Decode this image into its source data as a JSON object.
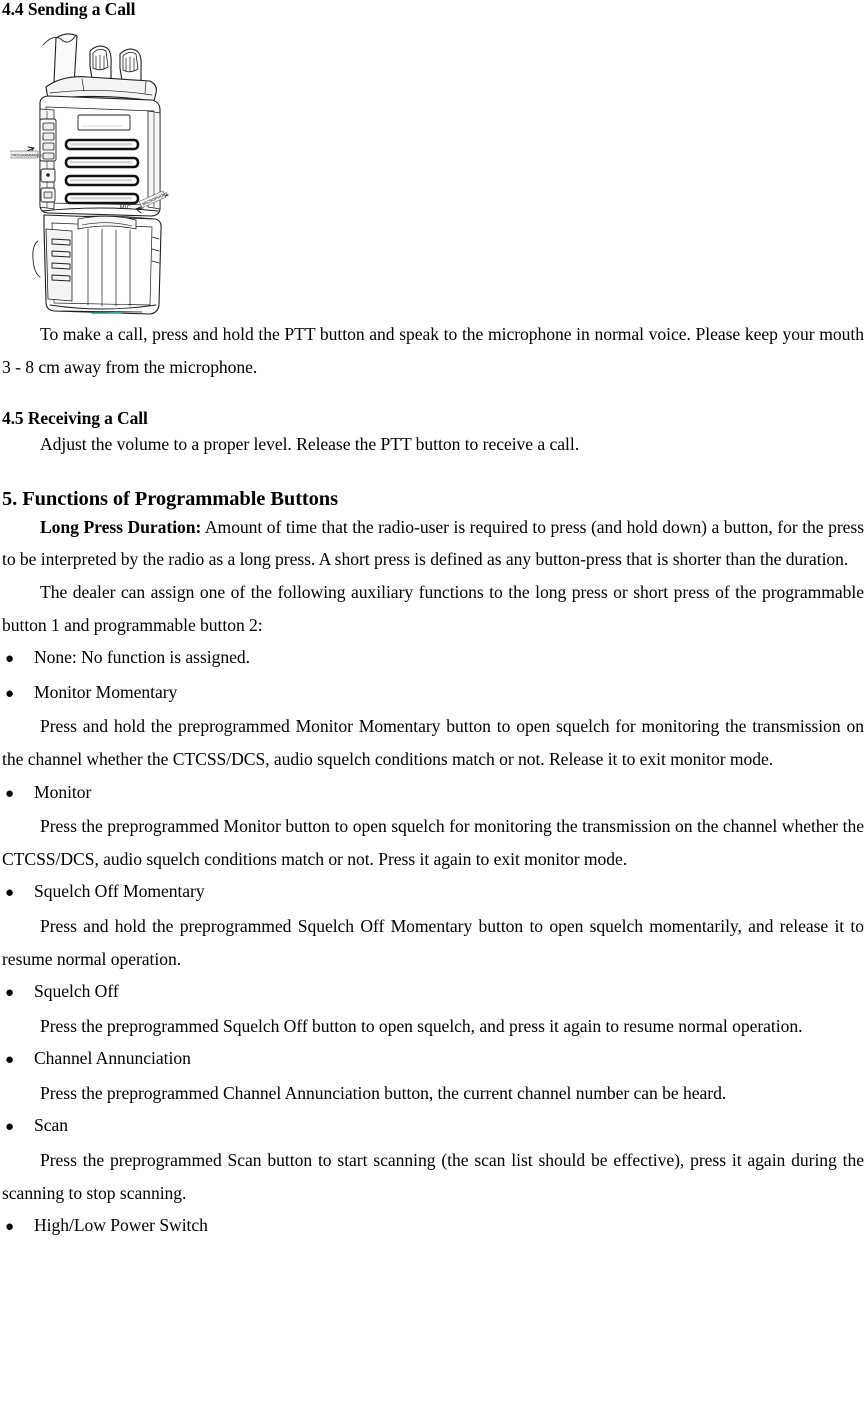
{
  "document": {
    "sections": [
      {
        "id": "sending-a-call",
        "heading": "4.4 Sending a Call",
        "paragraphs": [
          "To make a call, press and hold the PTT button and speak to the microphone in normal voice. Please keep your mouth 3 - 8 cm away from the microphone."
        ]
      },
      {
        "id": "receiving-a-call",
        "heading": "4.5 Receiving a Call",
        "paragraphs": [
          "Adjust the volume to a proper level. Release the PTT button to receive a call."
        ]
      },
      {
        "id": "programmable-buttons",
        "heading": "5. Functions of Programmable Buttons"
      }
    ],
    "long_press": {
      "label": "Long Press Duration:",
      "text": " Amount of time that the radio-user is required to press (and hold down) a button, for the press to be interpreted by the radio as a long press. A short press is defined as any button-press that is shorter than the duration."
    },
    "dealer_note": "The dealer can assign one of the following auxiliary functions to the long press or short press of the programmable button 1 and programmable button 2:",
    "bullet_glyph": "●",
    "functions": [
      {
        "name": "None: No function is assigned.",
        "description": null
      },
      {
        "name": "Monitor Momentary",
        "description": "Press and hold the preprogrammed Monitor Momentary button to open squelch for monitoring the transmission on the channel whether the CTCSS/DCS, audio squelch conditions match or not. Release it to exit monitor mode."
      },
      {
        "name": "Monitor",
        "description": "Press the preprogrammed Monitor button to open squelch for monitoring the transmission on the channel whether the CTCSS/DCS, audio squelch conditions match or not. Press it again to exit monitor mode."
      },
      {
        "name": "Squelch Off Momentary",
        "description": "Press and hold the preprogrammed Squelch Off Momentary button to open squelch momentarily, and release it to resume normal operation."
      },
      {
        "name": "Squelch Off",
        "description": "Press the preprogrammed Squelch Off button to open squelch, and press it again to resume normal operation."
      },
      {
        "name": "Channel Annunciation",
        "description": "Press the preprogrammed Channel Annunciation button, the current channel number can be heard."
      },
      {
        "name": "Scan",
        "description": "Press the preprogrammed Scan button to start scanning (the scan list should be effective), press it again during the scanning to stop scanning."
      },
      {
        "name": "High/Low Power Switch",
        "description": null
      }
    ],
    "figure": {
      "alt": "Line drawing of a handheld two-way radio",
      "callouts": [
        {
          "label": "PROGRAMMABLE",
          "target": "side-buttons"
        },
        {
          "label": "MIC",
          "target": "microphone"
        }
      ],
      "line_color": "#1a1a1a"
    }
  }
}
